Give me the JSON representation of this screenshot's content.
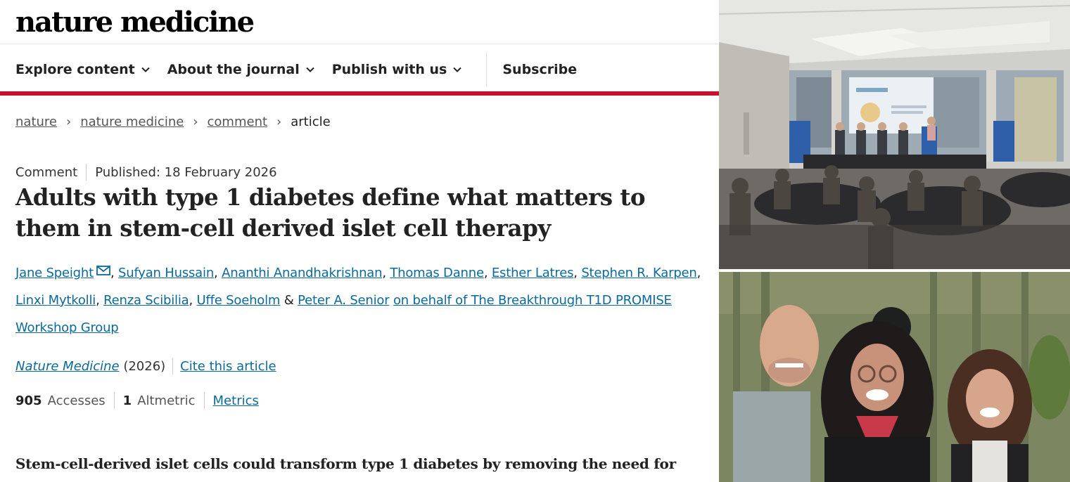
{
  "header": {
    "logo_text": "nature medicine",
    "nav": [
      {
        "label": "Explore content"
      },
      {
        "label": "About the journal"
      },
      {
        "label": "Publish with us"
      }
    ],
    "subscribe_label": "Subscribe"
  },
  "breadcrumb": {
    "items": [
      "nature",
      "nature medicine",
      "comment"
    ],
    "current": "article"
  },
  "article": {
    "type": "Comment",
    "published": "Published: 18 February 2026",
    "title": "Adults with type 1 diabetes define what matters to them in stem-cell derived islet cell therapy",
    "authors": [
      "Jane Speight",
      "Sufyan Hussain",
      "Ananthi Anandhakrishnan",
      "Thomas Danne",
      "Esther Latres",
      "Stephen R. Karpen",
      "Linxi Mytkolli",
      "Renza Scibilia",
      "Uffe Soeholm",
      "Peter A. Senior"
    ],
    "author_sep": ", ",
    "ampersand": " & ",
    "group": "on behalf of The Breakthrough T1D PROMISE Workshop Group",
    "journal": "Nature Medicine",
    "year": "(2026)",
    "cite_label": "Cite this article",
    "lede": "Stem-cell-derived islet cells could transform type 1 diabetes by removing the need for"
  },
  "metrics": {
    "accesses_value": "905",
    "accesses_label": "Accesses",
    "altmetric_value": "1",
    "altmetric_label": "Altmetric",
    "metrics_link": "Metrics"
  },
  "colors": {
    "brand_red": "#c8102e",
    "link_blue": "#0b6a9c"
  }
}
